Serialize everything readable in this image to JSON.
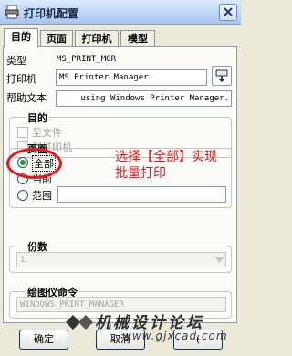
{
  "window": {
    "title": "打印机配置",
    "close_icon": "close-icon",
    "app_icon": "printer-icon"
  },
  "tabs": [
    "目的",
    "页面",
    "打印机",
    "模型"
  ],
  "type_row": {
    "label": "类型",
    "value": "MS_PRINT_MGR"
  },
  "printer_row": {
    "label": "打印机",
    "value": "MS Printer Manager",
    "browse_icon": "printer-browse-icon"
  },
  "help_row": {
    "label": "帮助文本",
    "value": "using Windows Printer Manager."
  },
  "destination": {
    "title": "目的",
    "options": [
      {
        "label": "至文件",
        "checked": false
      },
      {
        "label": "到打印机",
        "checked": false
      }
    ]
  },
  "pages": {
    "title": "页面",
    "options": [
      {
        "label": "全部",
        "selected": true
      },
      {
        "label": "当前",
        "selected": false
      },
      {
        "label": "范围",
        "selected": false
      }
    ],
    "range_value": ""
  },
  "copies": {
    "title": "份数",
    "value": "1"
  },
  "plotter_cmd": {
    "title": "绘图仪命令",
    "value": "WINDOWS_PRINT_MANAGER"
  },
  "annotation": {
    "line1": "选择【全部】实现",
    "line2": "批量打印",
    "color": "#e8161b"
  },
  "watermark": {
    "line1": "机械设计论坛",
    "line2": "www.gjxcad.com"
  },
  "buttons": {
    "ok": "确定",
    "cancel": "取消",
    "other": "("
  }
}
